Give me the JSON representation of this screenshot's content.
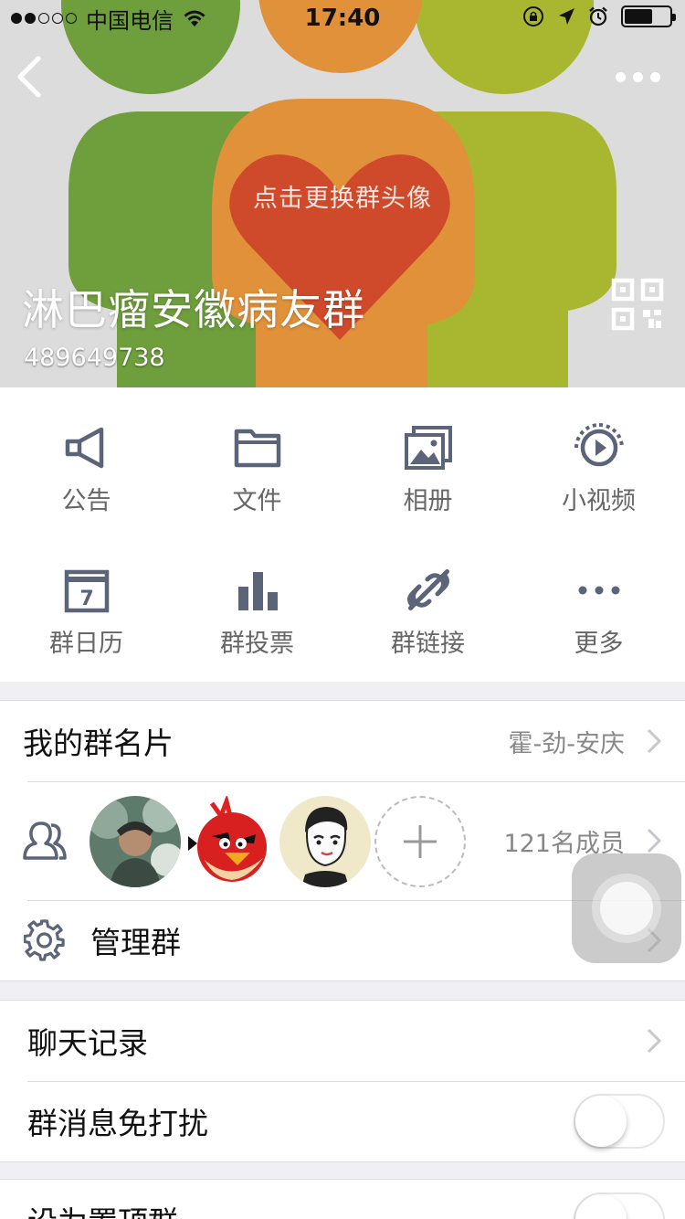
{
  "status_bar": {
    "carrier": "中国电信",
    "time": "17:40"
  },
  "header": {
    "change_avatar_hint": "点击更换群头像",
    "group_name": "淋巴瘤安徽病友群",
    "group_id": "489649738"
  },
  "features": [
    {
      "label": "公告",
      "icon": "megaphone-icon"
    },
    {
      "label": "文件",
      "icon": "folder-icon"
    },
    {
      "label": "相册",
      "icon": "album-icon"
    },
    {
      "label": "小视频",
      "icon": "video-icon"
    },
    {
      "label": "群日历",
      "icon": "calendar-icon"
    },
    {
      "label": "群投票",
      "icon": "bar-chart-icon"
    },
    {
      "label": "群链接",
      "icon": "link-icon"
    },
    {
      "label": "更多",
      "icon": "more-icon"
    }
  ],
  "calendar_day": "7",
  "card": {
    "label": "我的群名片",
    "value": "霍-劲-安庆"
  },
  "members": {
    "count_label": "121名成员"
  },
  "manage": {
    "label": "管理群"
  },
  "chat_history": {
    "label": "聊天记录"
  },
  "mute": {
    "label": "群消息免打扰",
    "on": false
  },
  "pin": {
    "label": "设为置顶群",
    "on": false
  },
  "colors": {
    "icon": "#5b6478",
    "green": "#6b9c3a",
    "orange": "#e0913a",
    "yellow_green": "#a8b62f",
    "heart": "#cf4a2a"
  }
}
